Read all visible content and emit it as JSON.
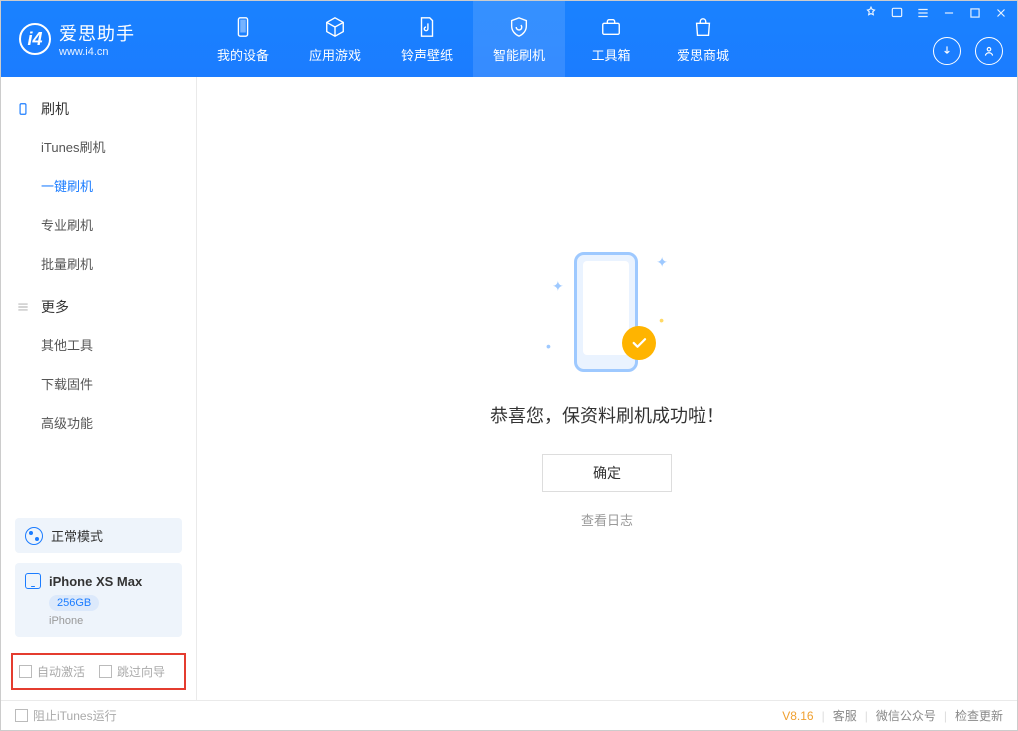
{
  "app": {
    "name_cn": "爱思助手",
    "url": "www.i4.cn"
  },
  "nav": {
    "items": [
      {
        "label": "我的设备"
      },
      {
        "label": "应用游戏"
      },
      {
        "label": "铃声壁纸"
      },
      {
        "label": "智能刷机"
      },
      {
        "label": "工具箱"
      },
      {
        "label": "爱思商城"
      }
    ]
  },
  "sidebar": {
    "groups": [
      {
        "title": "刷机",
        "items": [
          {
            "label": "iTunes刷机"
          },
          {
            "label": "一键刷机",
            "active": true
          },
          {
            "label": "专业刷机"
          },
          {
            "label": "批量刷机"
          }
        ]
      },
      {
        "title": "更多",
        "items": [
          {
            "label": "其他工具"
          },
          {
            "label": "下载固件"
          },
          {
            "label": "高级功能"
          }
        ]
      }
    ],
    "mode_label": "正常模式",
    "device": {
      "name": "iPhone XS Max",
      "storage": "256GB",
      "family": "iPhone"
    },
    "checkboxes": {
      "auto_activate": "自动激活",
      "skip_guide": "跳过向导"
    }
  },
  "main": {
    "success_text": "恭喜您，保资料刷机成功啦！",
    "ok_label": "确定",
    "log_link": "查看日志"
  },
  "footer": {
    "left_label": "阻止iTunes运行",
    "version": "V8.16",
    "links": [
      "客服",
      "微信公众号",
      "检查更新"
    ]
  }
}
